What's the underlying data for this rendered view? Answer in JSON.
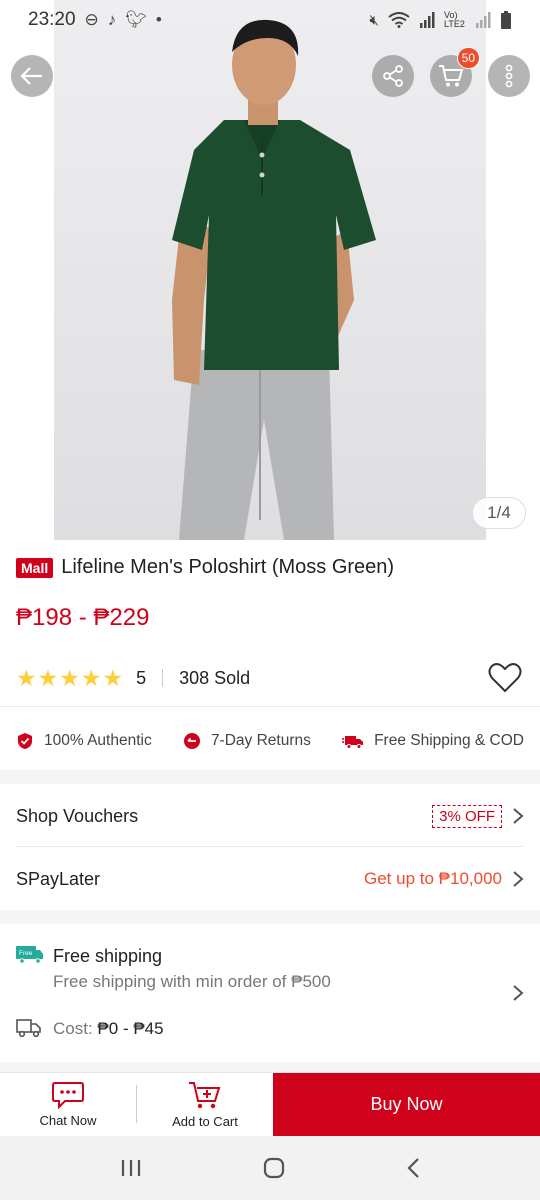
{
  "status": {
    "time": "23:20",
    "left_icons": [
      "dnd-icon",
      "tiktok-icon",
      "twitter-icon",
      "dot-icon"
    ],
    "right_icons": [
      "mute-icon",
      "wifi-icon",
      "signal-icon",
      "lte-icon",
      "battery-icon"
    ],
    "lte_label": "Vo) LTE2"
  },
  "header": {
    "cart_count": "50"
  },
  "gallery": {
    "counter": "1/4"
  },
  "product": {
    "mall_label": "Mall",
    "title": "Lifeline Men's Poloshirt (Moss Green)",
    "price": "₱198 - ₱229",
    "rating": "5",
    "stars": "★★★★★",
    "sold": "308 Sold"
  },
  "guarantees": [
    {
      "label": "100% Authentic",
      "icon": "shield-check-icon"
    },
    {
      "label": "7-Day Returns",
      "icon": "return-icon"
    },
    {
      "label": "Free Shipping & COD",
      "icon": "delivery-truck-icon"
    }
  ],
  "vouchers": {
    "label": "Shop Vouchers",
    "tag": "3% OFF"
  },
  "paylater": {
    "label": "SPayLater",
    "text": "Get up to ₱10,000"
  },
  "shipping": {
    "badge": "Free",
    "title": "Free shipping",
    "subtitle": "Free shipping with min order of ₱500",
    "cost_label": "Cost:",
    "cost_value": "₱0 - ₱45"
  },
  "actions": {
    "chat": "Chat Now",
    "add_to_cart": "Add to Cart",
    "buy_now": "Buy Now"
  },
  "colors": {
    "brand_red": "#d0011b",
    "orange": "#ee4d2d",
    "star": "#ffce3d",
    "free_ship_teal": "#26aa99"
  }
}
